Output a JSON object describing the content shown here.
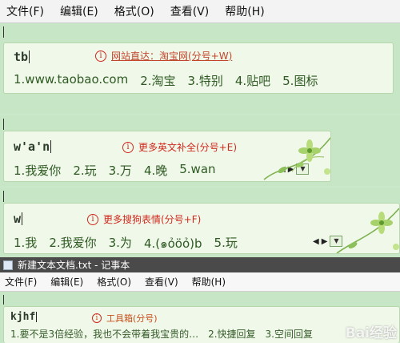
{
  "menubar_top": {
    "items": [
      "文件(F)",
      "编辑(E)",
      "格式(O)",
      "查看(V)",
      "帮助(H)"
    ]
  },
  "ime1": {
    "pinyin": "tb",
    "hint": "网站直达：淘宝网(分号+W)",
    "candidates": [
      "1.www.taobao.com",
      "2.淘宝",
      "3.特别",
      "4.贴吧",
      "5.图标"
    ]
  },
  "ime2": {
    "pinyin": "w'a'n",
    "hint": "更多英文补全(分号+E)",
    "candidates": [
      "1.我爱你",
      "2.玩",
      "3.万",
      "4.晚",
      "5.wan"
    ]
  },
  "ime3": {
    "pinyin": "w",
    "hint": "更多搜狗表情(分号+F)",
    "candidates": [
      "1.我",
      "2.我爱你",
      "3.为",
      "4.(๑ỏӧỏ)b",
      "5.玩"
    ]
  },
  "notepad": {
    "title": "新建文本文档.txt - 记事本",
    "menu": [
      "文件(F)",
      "编辑(E)",
      "格式(O)",
      "查看(V)",
      "帮助(H)"
    ]
  },
  "ime4": {
    "pinyin": "kjhf",
    "hint": "工具箱(分号)",
    "candidates": [
      "1.要不是3倍经验，我也不会带着我宝贵的…",
      "2.快捷回复",
      "3.空间回复"
    ]
  },
  "watermark": "Bai经验",
  "icons": {
    "info": "info-circle-icon",
    "prev": "triangle-left-icon",
    "next": "triangle-right-icon",
    "menu": "dropdown-icon",
    "flower": "flower-decoration",
    "app": "notepad-app-icon"
  },
  "colors": {
    "background": "#c9e8c9",
    "ime_panel": "#f0f8ea",
    "hint_red": "#cf2a1e",
    "candidate_green": "#2e5a22"
  }
}
